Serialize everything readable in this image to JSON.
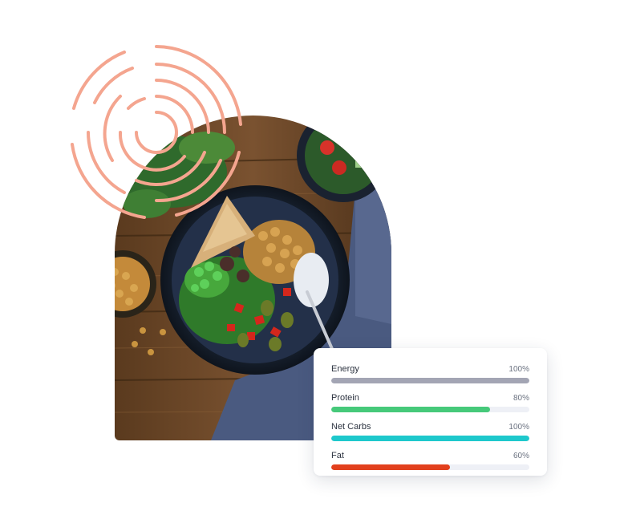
{
  "decoration": {
    "swirl_icon": "concentric-arc-swirl",
    "swirl_color": "#f4a58f"
  },
  "photo": {
    "subject": "food-bowl-photo"
  },
  "nutrition_card": {
    "items": [
      {
        "label": "Energy",
        "percent_label": "100%",
        "fill": 1.0,
        "color": "#a3a5b4"
      },
      {
        "label": "Protein",
        "percent_label": "80%",
        "fill": 0.8,
        "color": "#46c97a"
      },
      {
        "label": "Net Carbs",
        "percent_label": "100%",
        "fill": 1.0,
        "color": "#1ec8cc"
      },
      {
        "label": "Fat",
        "percent_label": "60%",
        "fill": 0.6,
        "color": "#e2401d"
      }
    ]
  }
}
